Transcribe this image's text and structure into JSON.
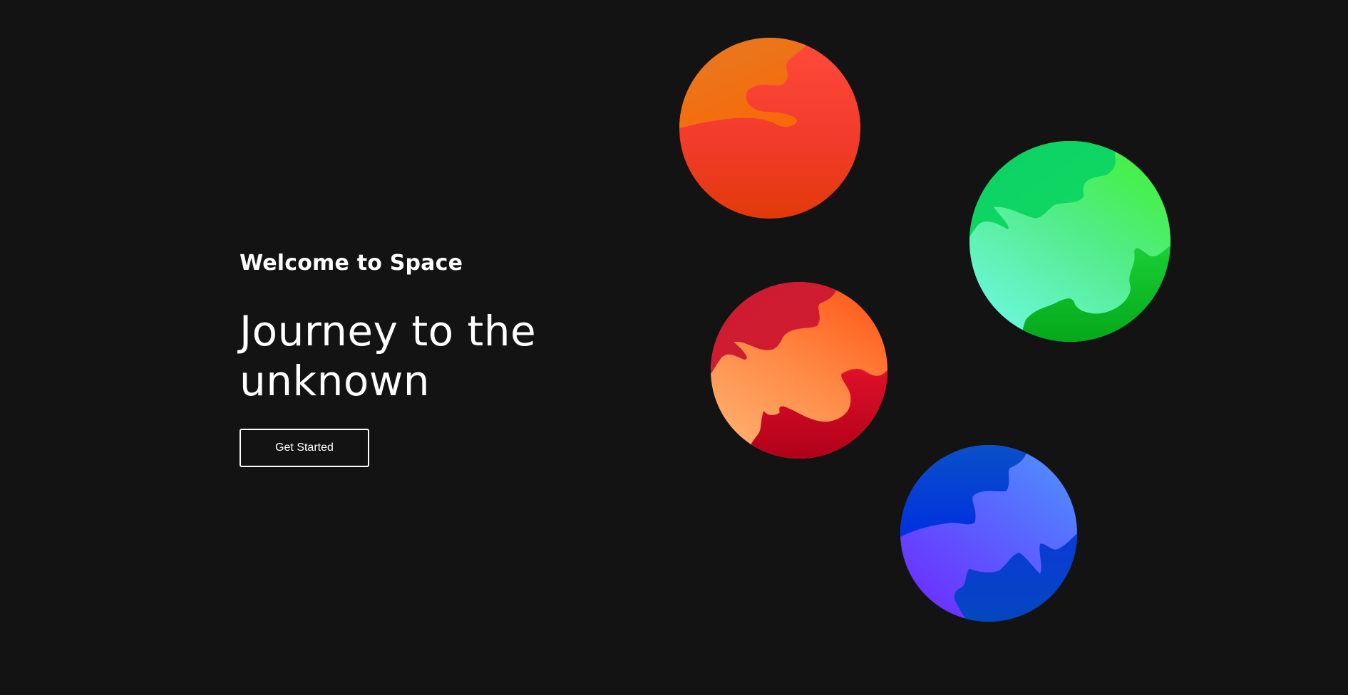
{
  "hero": {
    "eyebrow": "Welcome to Space",
    "headline": "Journey to the\nunknown",
    "cta_label": "Get Started"
  },
  "colors": {
    "background": "#131313",
    "text": "#ffffff"
  },
  "planets": [
    {
      "name": "orange-planet",
      "colors": [
        "#f06a0f",
        "#f33b2c",
        "#e23a0a"
      ]
    },
    {
      "name": "green-planet",
      "colors": [
        "#0bd466",
        "#40f231",
        "#66f2df"
      ]
    },
    {
      "name": "red-planet",
      "colors": [
        "#cf1b30",
        "#ff5a1a",
        "#ffa265"
      ]
    },
    {
      "name": "blue-planet",
      "colors": [
        "#0043d4",
        "#4f88ff",
        "#7028ff"
      ]
    }
  ]
}
